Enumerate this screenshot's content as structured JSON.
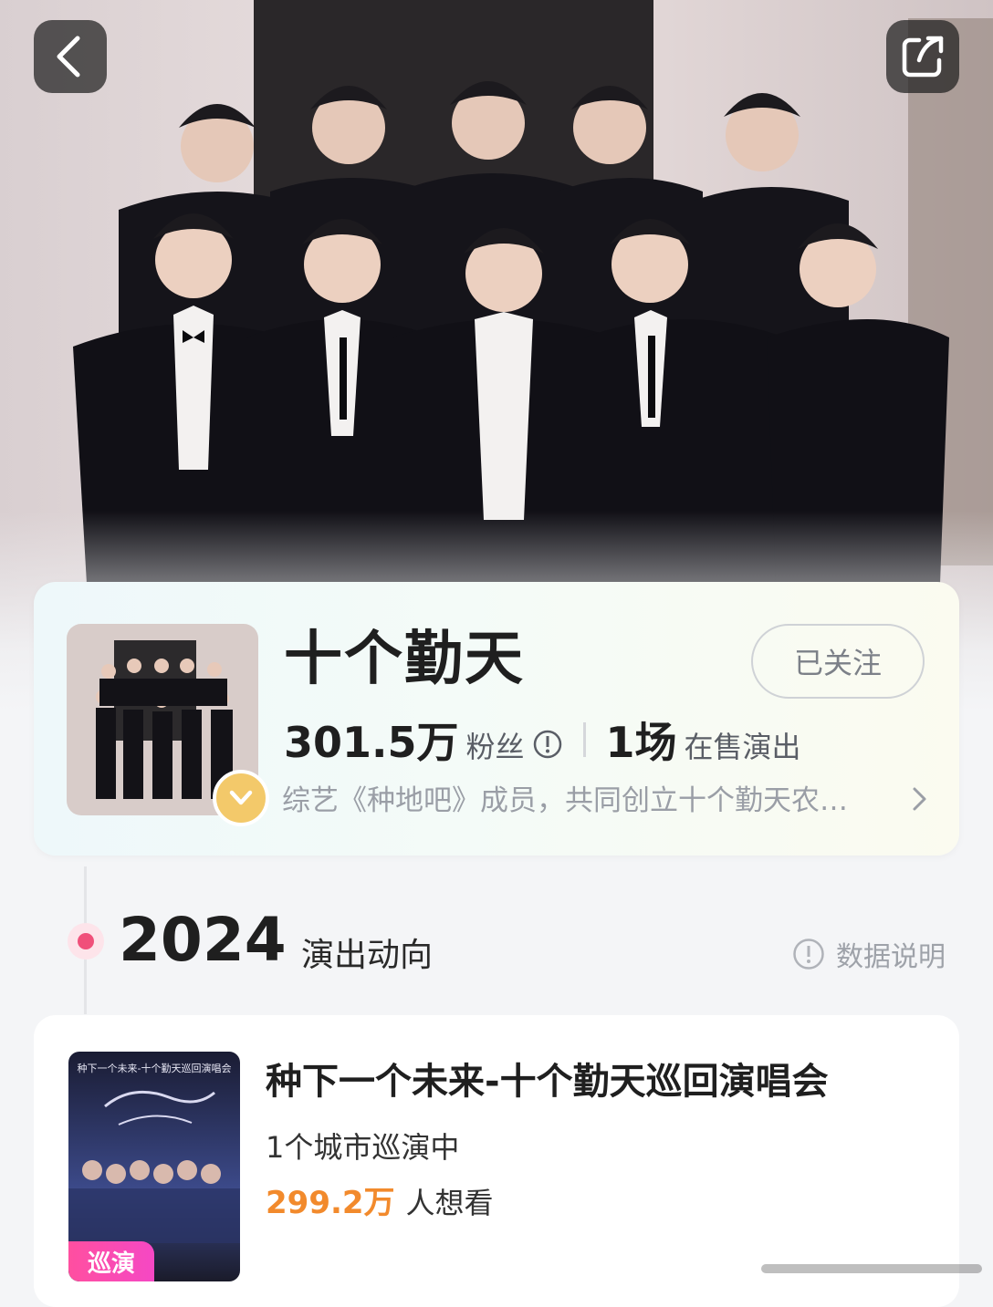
{
  "nav": {
    "back_icon": "chevron-left-icon",
    "share_icon": "share-icon"
  },
  "artist": {
    "name": "十个勤天",
    "follow_label": "已关注",
    "fans_count": "301.5万",
    "fans_label": "粉丝",
    "shows_count": "1场",
    "shows_label": "在售演出",
    "description": "综艺《种地吧》成员，共同创立十个勤天农…",
    "verified_badge": "v-badge-icon"
  },
  "timeline": {
    "year": "2024",
    "section_title": "演出动向",
    "data_note": "数据说明"
  },
  "show": {
    "title": "种下一个未来-十个勤天巡回演唱会",
    "cities": "1个城市巡演中",
    "want_count": "299.2万",
    "want_label": "人想看",
    "tag": "巡演",
    "poster_caption": "种下一个未来-十个勤天巡回演唱会"
  },
  "colors": {
    "accent_orange": "#f28a2c",
    "tag_pink": "#ff4fa0",
    "timeline_dot": "#f0507a"
  }
}
